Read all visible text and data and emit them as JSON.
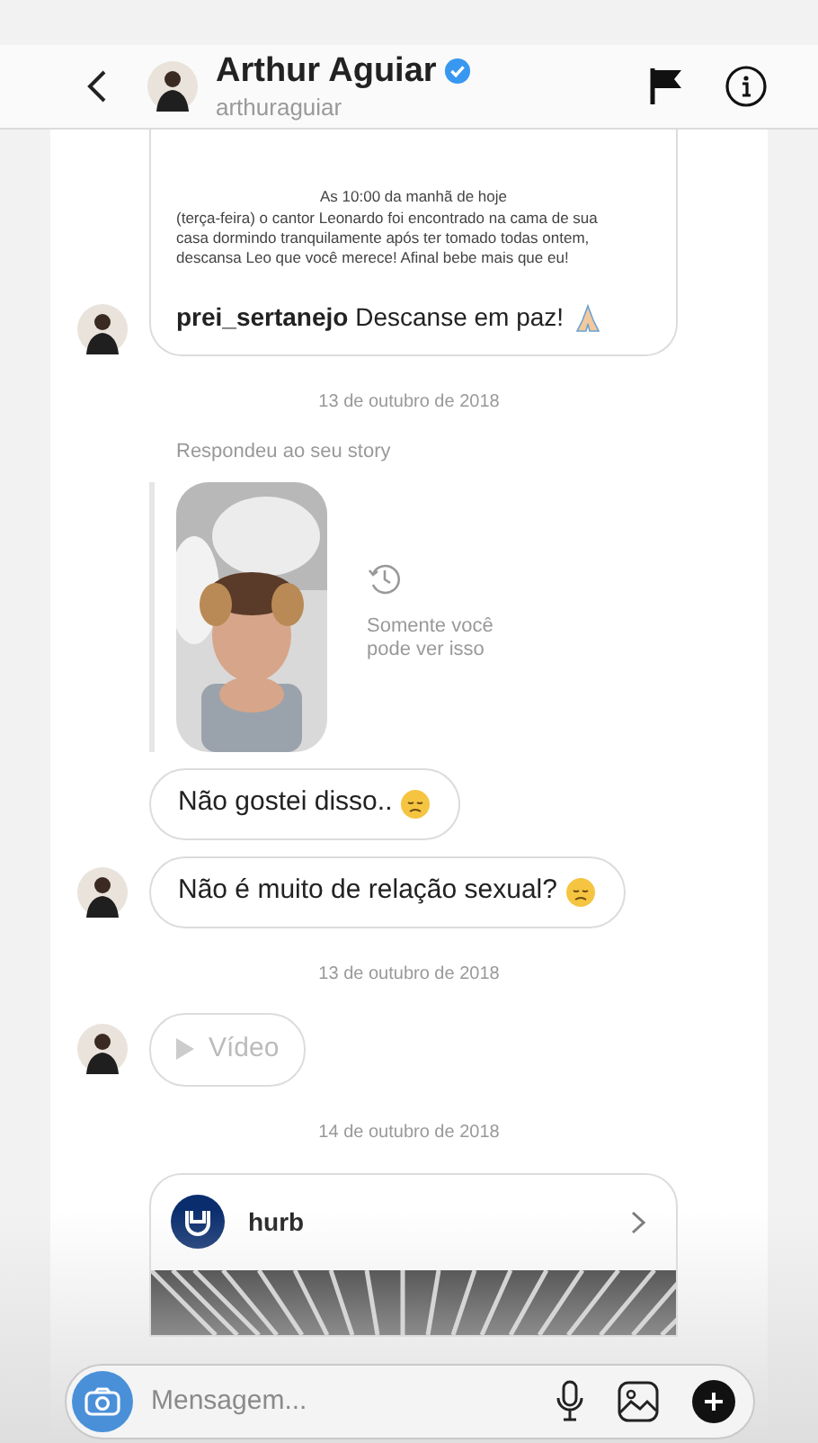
{
  "header": {
    "title": "Arthur Aguiar",
    "verified": true,
    "username": "arthuraguiar"
  },
  "messages": [
    {
      "kind": "post",
      "heading": "As 10:00 da manhã de hoje",
      "body": "(terça-feira) o cantor Leonardo foi encontrado na cama de sua casa dormindo tranquilamente após ter tomado todas ontem, descansa Leo que você merece! Afinal bebe mais que eu!",
      "user": "prei_sertanejo",
      "caption": "Descanse em paz!",
      "avatar": true
    },
    {
      "kind": "date",
      "text": "13 de outubro de 2018"
    },
    {
      "kind": "story",
      "label": "Respondeu ao seu story",
      "note": "Somente você pode ver isso"
    },
    {
      "kind": "text",
      "text": "Não gostei disso..",
      "avatar": false
    },
    {
      "kind": "text",
      "text": "Não é muito de relação sexual?",
      "avatar": true
    },
    {
      "kind": "date",
      "text": "13 de outubro de 2018"
    },
    {
      "kind": "video",
      "text": "Vídeo",
      "avatar": true
    },
    {
      "kind": "date",
      "text": "14 de outubro de 2018"
    },
    {
      "kind": "link",
      "title": "hurb"
    }
  ],
  "composer": {
    "placeholder": "Mensagem..."
  }
}
